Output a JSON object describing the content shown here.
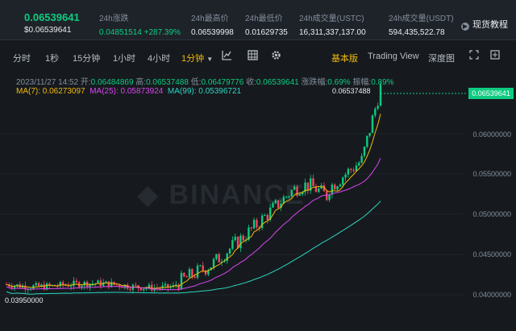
{
  "header": {
    "price_main": "0.06539641",
    "price_sub": "$0.06539641",
    "stats": [
      {
        "label": "24h涨跌",
        "value": "0.04851514 +287.39%"
      },
      {
        "label": "24h最高价",
        "value": "0.06539998"
      },
      {
        "label": "24h最低价",
        "value": "0.01629735"
      },
      {
        "label": "24h成交量(USTC)",
        "value": "16,311,337,137.00"
      },
      {
        "label": "24h成交量(USDT)",
        "value": "594,435,522.78"
      }
    ],
    "tutorial": "现货教程"
  },
  "toolbar": {
    "intervals": [
      "分时",
      "1秒",
      "15分钟",
      "1小时",
      "4小时",
      "1分钟"
    ],
    "basic": "基本版",
    "tradingview": "Trading View",
    "depth": "深度图"
  },
  "ohlc": {
    "time": "2023/11/27 14:52",
    "open_label": "开:",
    "open": "0.06484869",
    "high_label": "高:",
    "high": "0.06537488",
    "low_label": "低:",
    "low": "0.06479776",
    "close_label": "收:",
    "close": "0.06539641",
    "change_label": "涨跌幅:",
    "change": "0.69%",
    "amp_label": "振幅:",
    "amp": "0.89%"
  },
  "ma": {
    "ma7": "MA(7): 0.06273097",
    "ma25": "MA(25): 0.05873924",
    "ma99": "MA(99): 0.05396721"
  },
  "axis": {
    "labels": [
      "0.06000000",
      "0.05500000",
      "0.05000000",
      "0.04500000",
      "0.04000000"
    ],
    "current": "0.06539641"
  },
  "annotations": {
    "high": "0.06537488",
    "low": "0.03950000"
  },
  "colors": {
    "up": "#0ecb81",
    "down": "#f6465d",
    "accent": "#f0b90b"
  }
}
